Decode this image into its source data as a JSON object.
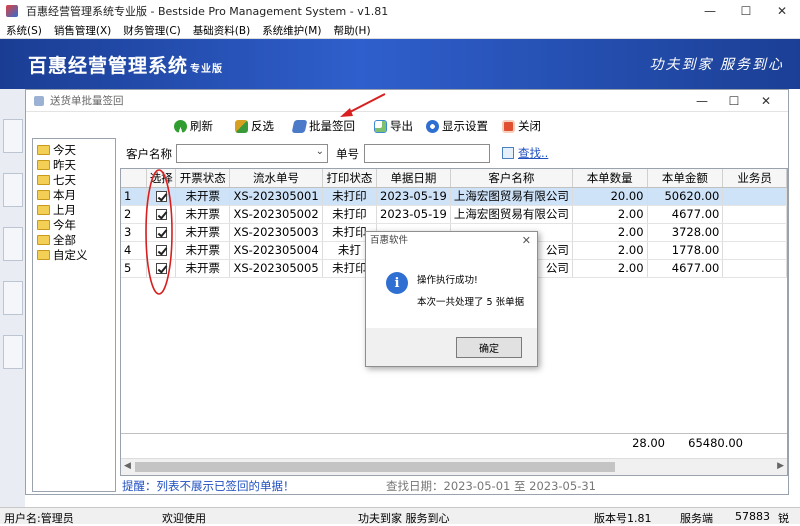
{
  "window": {
    "title": "百惠经营管理系统专业版 - Bestside Pro Management System - v1.81",
    "min": "—",
    "max": "☐",
    "close": "✕"
  },
  "menu": [
    "系统(S)",
    "销售管理(X)",
    "财务管理(C)",
    "基础资料(B)",
    "系统维护(M)",
    "帮助(H)"
  ],
  "banner": {
    "brand": "百惠经营管理系统",
    "edition": "专业版",
    "slogan": "功夫到家 服务到心"
  },
  "child": {
    "title": "送货单批量签回",
    "toolbar": {
      "refresh": "刷新",
      "invert": "反选",
      "batch": "批量签回",
      "export": "导出",
      "display": "显示设置",
      "close": "关闭"
    },
    "tree": [
      "今天",
      "昨天",
      "七天",
      "本月",
      "上月",
      "今年",
      "全部",
      "自定义"
    ],
    "filter": {
      "customer_label": "客户名称",
      "customer_value": "",
      "no_label": "单号",
      "no_value": "",
      "search": "查找.."
    },
    "grid": {
      "columns": [
        "",
        "选择",
        "开票状态",
        "流水单号",
        "打印状态",
        "单据日期",
        "客户名称",
        "本单数量",
        "本单金额",
        "业务员"
      ],
      "rows": [
        {
          "n": "1",
          "invoice": "未开票",
          "serial": "XS-202305001",
          "print": "未打印",
          "date": "2023-05-19",
          "customer": "上海宏图贸易有限公司",
          "qty": "20.00",
          "amount": "50620.00"
        },
        {
          "n": "2",
          "invoice": "未开票",
          "serial": "XS-202305002",
          "print": "未打印",
          "date": "2023-05-19",
          "customer": "上海宏图贸易有限公司",
          "qty": "2.00",
          "amount": "4677.00"
        },
        {
          "n": "3",
          "invoice": "未开票",
          "serial": "XS-202305003",
          "print": "未打印",
          "date": "",
          "customer": "",
          "qty": "2.00",
          "amount": "3728.00"
        },
        {
          "n": "4",
          "invoice": "未开票",
          "serial": "XS-202305004",
          "print": "未打",
          "date": "",
          "customer": "公司",
          "qty": "2.00",
          "amount": "1778.00"
        },
        {
          "n": "5",
          "invoice": "未开票",
          "serial": "XS-202305005",
          "print": "未打印",
          "date": "",
          "customer": "公司",
          "qty": "2.00",
          "amount": "4677.00"
        }
      ],
      "total_qty": "28.00",
      "total_amount": "65480.00"
    },
    "tip": "提醒：列表不展示已签回的单据！",
    "daterange": "查找日期：2023-05-01 至 2023-05-31"
  },
  "dialog": {
    "title": "百惠软件",
    "close": "✕",
    "msg1": "操作执行成功!",
    "msg2": "本次一共处理了 5 张单据",
    "ok": "确定"
  },
  "status": {
    "user": "用户名:管理员",
    "welcome": "欢迎使用",
    "slogan": "功夫到家 服务到心",
    "version": "版本号1.81",
    "service": "服务端",
    "code": "57883",
    "tail": "锐"
  },
  "colors": {
    "banner": "#2f5fcc",
    "annotation": "#d82020",
    "tip": "#1f4fc0",
    "selected_row": "#cfe3f8"
  }
}
